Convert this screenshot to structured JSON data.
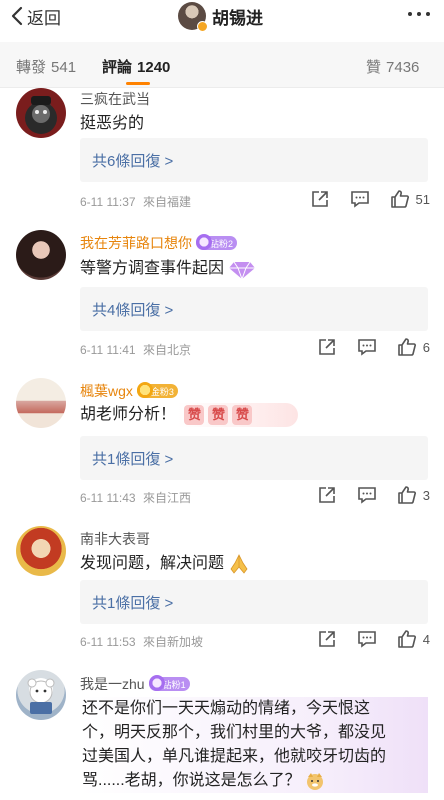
{
  "header": {
    "back_label": "返回",
    "title": "胡锡进"
  },
  "tabs": [
    {
      "label": "轉發",
      "count": "541"
    },
    {
      "label": "評論",
      "count": "1240"
    },
    {
      "label": "贊",
      "count": "7436"
    }
  ],
  "colors": {
    "accent_orange": "#ff8200",
    "reply_link": "#4a6fa5",
    "gold_name": "#e7850d"
  },
  "comments": [
    {
      "username": "三疯在武当",
      "text": "挺恶劣的",
      "replies": "共6條回復 >",
      "date": "6-11 11:37",
      "source": "來自福建",
      "likes": "51"
    },
    {
      "username": "我在芳菲路口想你",
      "badge": "钻粉2",
      "text": "等警方调查事件起因",
      "replies": "共4條回復 >",
      "date": "6-11 11:41",
      "source": "來自北京",
      "likes": "6"
    },
    {
      "username": "楓葉wgx",
      "badge": "金粉3",
      "text": "胡老师分析！",
      "stickers": [
        "赞",
        "赞",
        "赞"
      ],
      "replies": "共1條回復 >",
      "date": "6-11 11:43",
      "source": "來自江西",
      "likes": "3"
    },
    {
      "username": "南非大表哥",
      "text": "发现问题，解决问题",
      "replies": "共1條回復 >",
      "date": "6-11 11:53",
      "source": "來自新加坡",
      "likes": "4"
    },
    {
      "username": "我是一zhu",
      "badge": "钻粉1",
      "text_lines": [
        "还不是你们一天天煽动的情绪，今天恨这",
        "个，明天反那个，我们村里的大爷，都没见",
        "过美国人，单凡谁提起来，他就咬牙切齿的",
        "骂......老胡，你说这是怎么了？"
      ]
    }
  ]
}
